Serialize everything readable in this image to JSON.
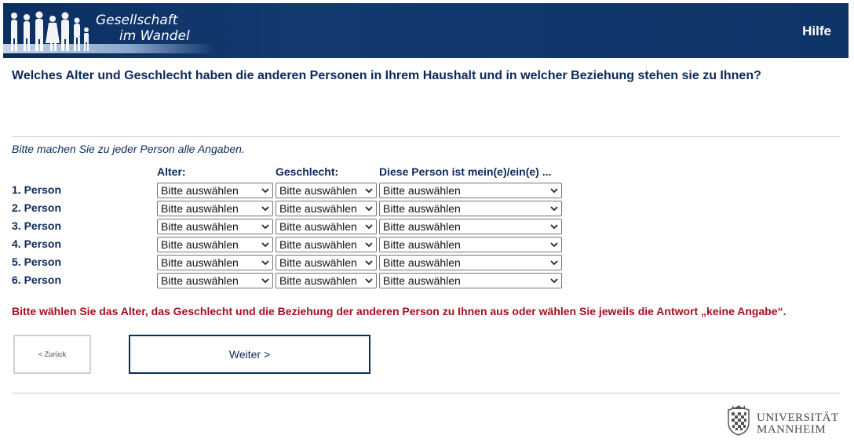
{
  "header": {
    "logo_line1": "Gesellschaft",
    "logo_line2": "im Wandel",
    "help_label": "Hilfe"
  },
  "question": "Welches Alter und Geschlecht haben die anderen Personen in Ihrem Haushalt und in welcher Beziehung stehen sie zu Ihnen?",
  "instruction": "Bitte machen Sie zu jeder Person alle Angaben.",
  "columns": {
    "age": "Alter:",
    "gender": "Geschlecht:",
    "relation": "Diese Person ist mein(e)/ein(e) ..."
  },
  "rows": [
    {
      "label": "1. Person",
      "age": "Bitte auswählen",
      "gender": "Bitte auswählen",
      "relation": "Bitte auswählen"
    },
    {
      "label": "2. Person",
      "age": "Bitte auswählen",
      "gender": "Bitte auswählen",
      "relation": "Bitte auswählen"
    },
    {
      "label": "3. Person",
      "age": "Bitte auswählen",
      "gender": "Bitte auswählen",
      "relation": "Bitte auswählen"
    },
    {
      "label": "4. Person",
      "age": "Bitte auswählen",
      "gender": "Bitte auswählen",
      "relation": "Bitte auswählen"
    },
    {
      "label": "5. Person",
      "age": "Bitte auswählen",
      "gender": "Bitte auswählen",
      "relation": "Bitte auswählen"
    },
    {
      "label": "6. Person",
      "age": "Bitte auswählen",
      "gender": "Bitte auswählen",
      "relation": "Bitte auswählen"
    }
  ],
  "error_message": "Bitte wählen Sie das Alter, das Geschlecht und die Beziehung der anderen Person zu Ihnen aus oder wählen Sie jeweils die Antwort „keine Angabe“.",
  "nav": {
    "back_label": "< Zurück",
    "next_label": "Weiter >"
  },
  "footer": {
    "uni_line1": "UNIVERSITÄT",
    "uni_line2": "MANNHEIM",
    "crest_icon": "university-crest-icon"
  },
  "colors": {
    "brand_blue": "#0c2f62",
    "error_red": "#a50f1d"
  }
}
